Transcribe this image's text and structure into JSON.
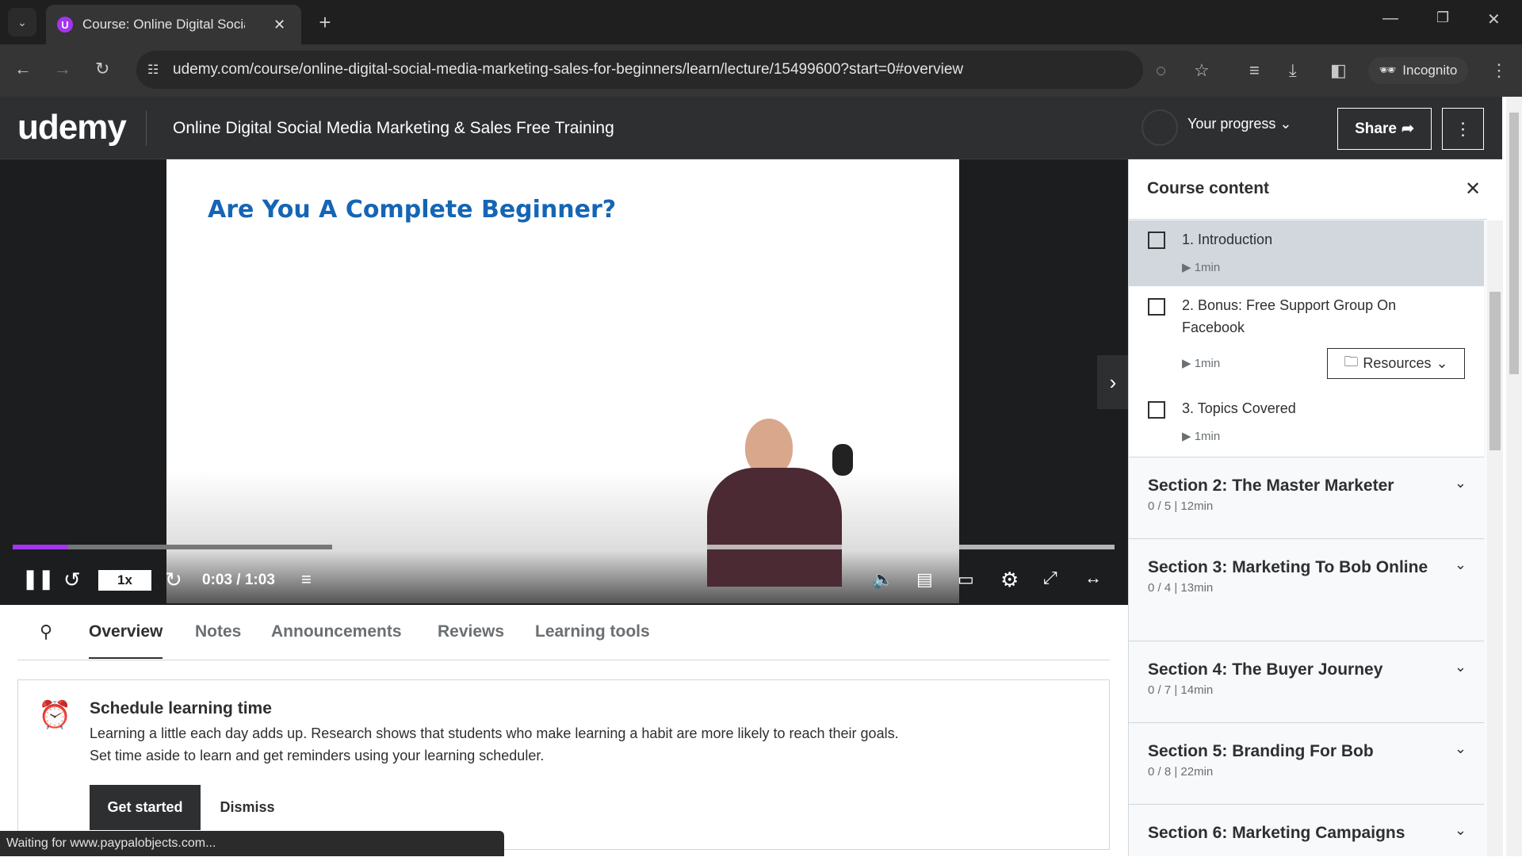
{
  "browser": {
    "tab_title": "Course: Online Digital Social",
    "url": "udemy.com/course/online-digital-social-media-marketing-sales-for-beginners/learn/lecture/15499600?start=0#overview",
    "incognito_label": "Incognito",
    "status_text": "Waiting for www.paypalobjects.com..."
  },
  "header": {
    "logo": "udemy",
    "course_title": "Online Digital Social Media Marketing & Sales Free Training",
    "progress_label": "Your progress",
    "share_label": "Share"
  },
  "video": {
    "slide_title": "Are You A Complete Beginner?",
    "speed": "1x",
    "time": "0:03 / 1:03",
    "progress_percent": 5,
    "buffered_percent": 29,
    "accent": "#a435f0"
  },
  "tabs": [
    "Overview",
    "Notes",
    "Announcements",
    "Reviews",
    "Learning tools"
  ],
  "schedule": {
    "title": "Schedule learning time",
    "body1": "Learning a little each day adds up. Research shows that students who make learning a habit are more likely to reach their goals.",
    "body2": "Set time aside to learn and get reminders using your learning scheduler.",
    "get_started": "Get started",
    "dismiss": "Dismiss"
  },
  "sidebar": {
    "title": "Course content",
    "lectures": [
      {
        "title": "1. Introduction",
        "duration": "1min"
      },
      {
        "title": "2. Bonus: Free Support Group On Facebook",
        "duration": "1min",
        "resources": "Resources"
      },
      {
        "title": "3. Topics Covered",
        "duration": "1min"
      }
    ],
    "sections": [
      {
        "title": "Section 2: The Master Marketer",
        "meta": "0 / 5 | 12min"
      },
      {
        "title": "Section 3: Marketing To Bob Online",
        "meta": "0 / 4 | 13min"
      },
      {
        "title": "Section 4: The Buyer Journey",
        "meta": "0 / 7 | 14min"
      },
      {
        "title": "Section 5: Branding For Bob",
        "meta": "0 / 8 | 22min"
      },
      {
        "title": "Section 6: Marketing Campaigns",
        "meta": ""
      }
    ]
  }
}
